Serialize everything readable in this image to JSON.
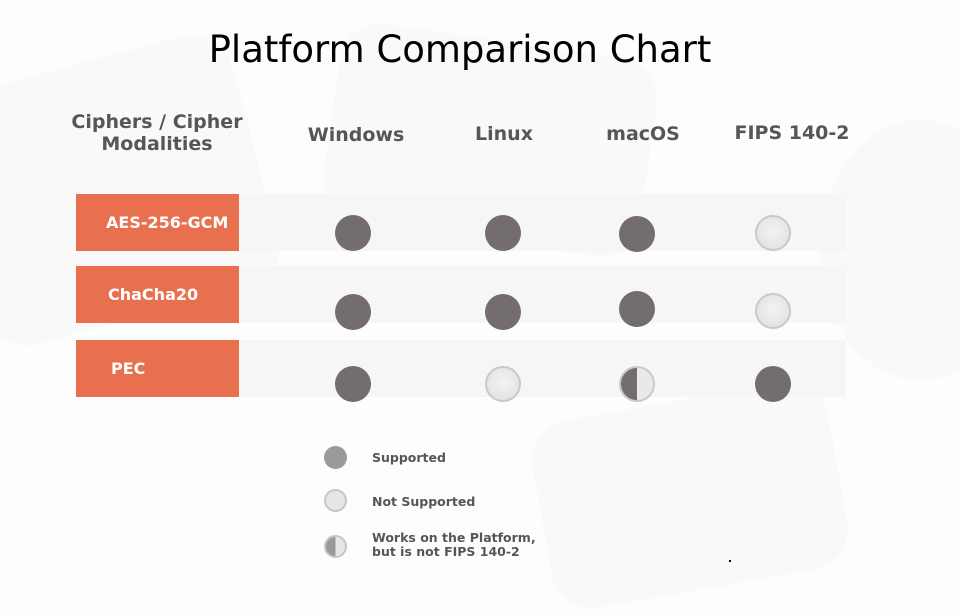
{
  "title": "Platform Comparison Chart",
  "chart_data": {
    "type": "table",
    "title": "Platform Comparison Chart",
    "row_header": "Ciphers / Cipher Modalities",
    "columns": [
      "Windows",
      "Linux",
      "macOS",
      "FIPS 140-2"
    ],
    "rows": [
      {
        "label": "AES-256-GCM",
        "values": [
          "supported",
          "supported",
          "supported",
          "not_supported"
        ]
      },
      {
        "label": "ChaCha20",
        "values": [
          "supported",
          "supported",
          "supported",
          "not_supported"
        ]
      },
      {
        "label": "PEC",
        "values": [
          "supported",
          "not_supported",
          "partial",
          "supported"
        ]
      }
    ],
    "legend": [
      {
        "key": "supported",
        "label": "Supported"
      },
      {
        "key": "not_supported",
        "label": "Not Supported"
      },
      {
        "key": "partial",
        "label": "Works on the Platform,\nbut is not FIPS 140-2"
      }
    ]
  },
  "colors": {
    "row_label_bg": "#e8704f",
    "supported": "#736e6d",
    "not_supported": "#e4e4e4",
    "header_text": "#565656"
  }
}
